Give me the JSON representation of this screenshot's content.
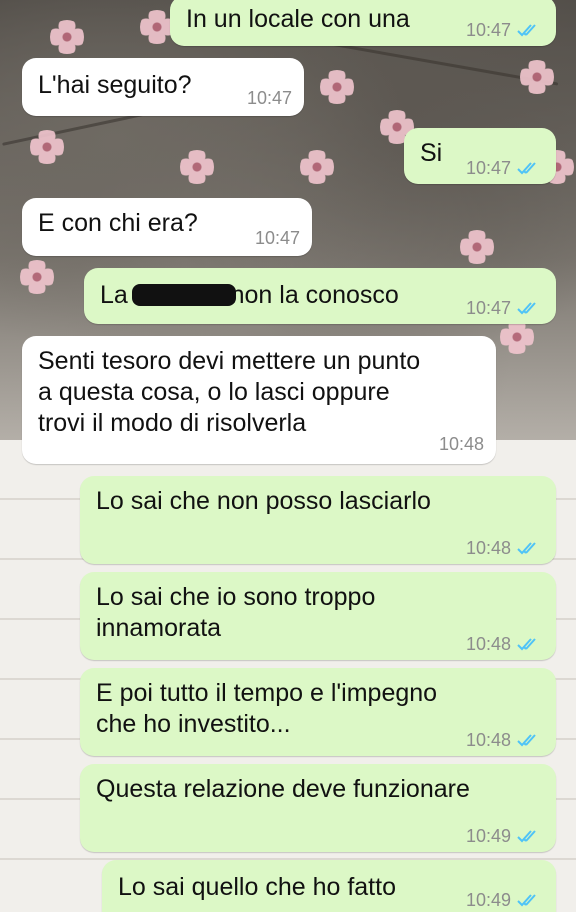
{
  "colors": {
    "outgoing_bubble": "#dcf8c6",
    "incoming_bubble": "#ffffff",
    "read_ticks": "#4fc3f7",
    "time_text": "#8c8c8c"
  },
  "messages": [
    {
      "dir": "out",
      "text": "In un locale con una",
      "time": "10:47",
      "status": "read-ticks-icon"
    },
    {
      "dir": "in",
      "text": "L'hai seguito?",
      "time": "10:47"
    },
    {
      "dir": "out",
      "text": "Si",
      "time": "10:47",
      "status": "read-ticks-icon"
    },
    {
      "dir": "in",
      "text": "E con chi era?",
      "time": "10:47"
    },
    {
      "dir": "out",
      "text": "La zo          non la conosco",
      "time": "10:47",
      "status": "read-ticks-icon"
    },
    {
      "dir": "in",
      "text": "Senti tesoro devi mettere un punto\na questa cosa, o lo lasci oppure\ntrovi il modo di risolverla",
      "time": "10:48"
    },
    {
      "dir": "out",
      "text": "Lo sai che non posso lasciarlo",
      "time": "10:48",
      "status": "read-ticks-icon"
    },
    {
      "dir": "out",
      "text": "Lo sai che io sono troppo\ninnamorata",
      "time": "10:48",
      "status": "read-ticks-icon"
    },
    {
      "dir": "out",
      "text": "E poi tutto il tempo e l'impegno\nche ho investito...",
      "time": "10:48",
      "status": "read-ticks-icon"
    },
    {
      "dir": "out",
      "text": "Questa relazione deve funzionare",
      "time": "10:49",
      "status": "read-ticks-icon"
    },
    {
      "dir": "out",
      "text": "Lo sai quello che ho fatto",
      "time": "10:49",
      "status": "read-ticks-icon"
    }
  ]
}
